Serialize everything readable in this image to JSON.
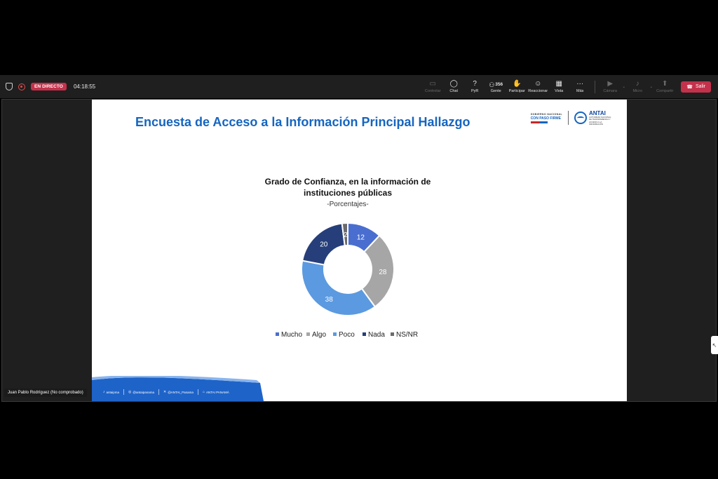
{
  "toolbar": {
    "live_label": "EN DIRECTO",
    "timer": "04:18:55",
    "buttons": {
      "control": "Controlar",
      "chat": "Chat",
      "pyr": "PyR",
      "people": "Gente",
      "people_count": "356",
      "participate": "Participar",
      "react": "Reaccionar",
      "view": "Vista",
      "more": "Más",
      "camera": "Cámara",
      "mic": "Micro",
      "share": "Compartir"
    },
    "leave_label": "Salir",
    "colors": {
      "leave": "#c4314b",
      "live": "#c4314b"
    }
  },
  "slide": {
    "title": "Encuesta de Acceso a la Información Principal Hallazgo",
    "logos": {
      "gov_small": "GOBIERNO NACIONAL",
      "gov_tagline": "CON PASO FIRME",
      "antai_name": "ANTAI",
      "antai_sub": "AUTORIDAD NACIONAL DE TRANSPARENCIA Y ACCESO A LA INFORMACIÓN"
    },
    "footer": {
      "handle1": "antaipma",
      "handle2": "@antaipanama",
      "handle3": "@ANTAI_Panama",
      "handle4": "ANTAI PANAMÁ"
    }
  },
  "chart_data": {
    "type": "pie",
    "variant": "donut",
    "title": "Grado de Confianza, en la información de instituciones públicas",
    "subtitle": "-Porcentajes-",
    "categories": [
      "Mucho",
      "Algo",
      "Poco",
      "Nada",
      "NS/NR"
    ],
    "values": [
      12,
      28,
      38,
      20,
      2
    ],
    "colors": [
      "#4a6ed0",
      "#a6a6a6",
      "#5b9ae0",
      "#263f7a",
      "#6b6b6b"
    ],
    "legend_position": "bottom"
  },
  "participant": {
    "name": "Juan Pablo Rodríguez (No comprobado)"
  }
}
